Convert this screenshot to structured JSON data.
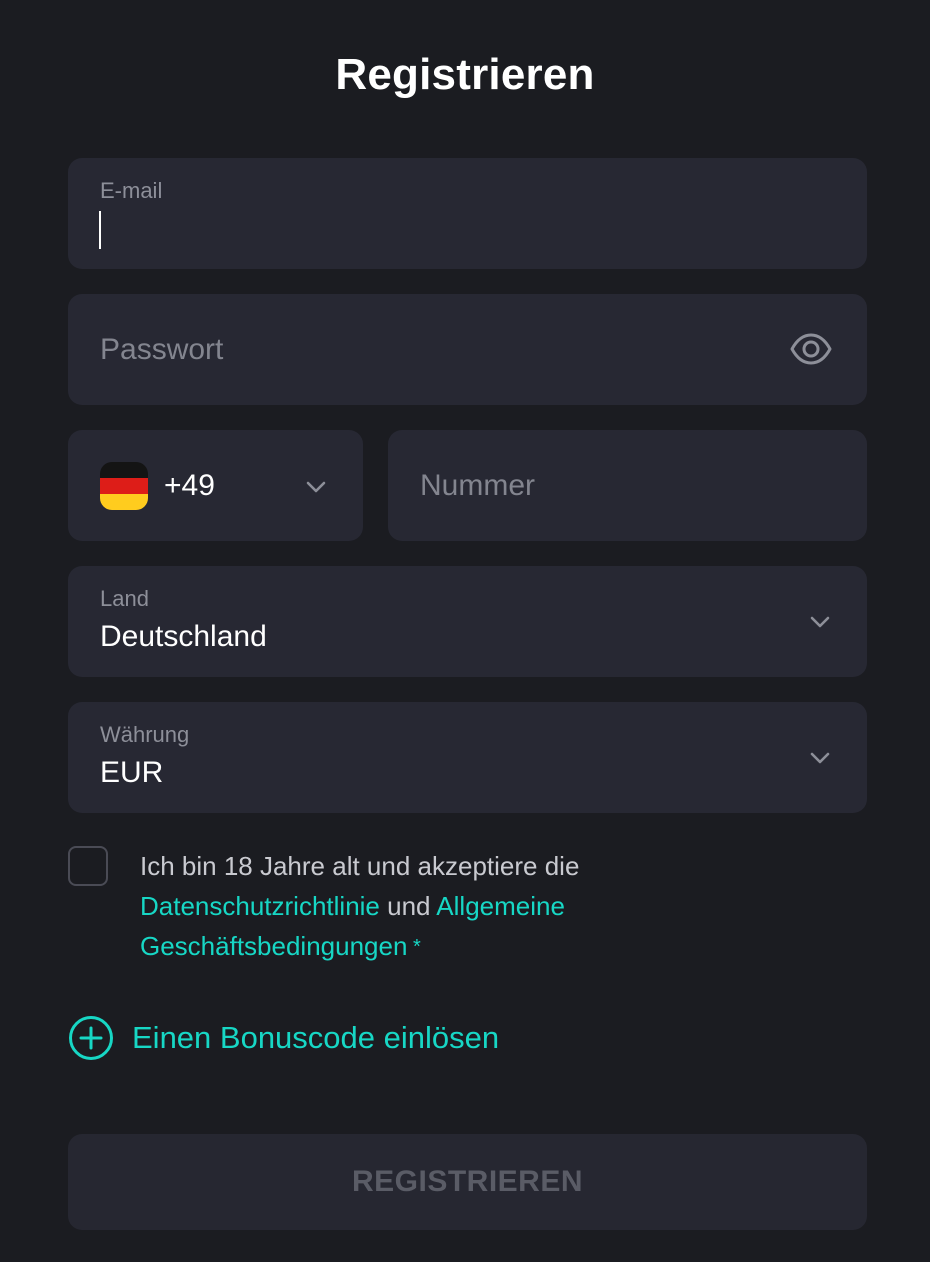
{
  "title": "Registrieren",
  "email": {
    "label": "E-mail",
    "value": ""
  },
  "password": {
    "placeholder": "Passwort",
    "icon": "eye-icon"
  },
  "phone": {
    "country_code": "+49",
    "flag": "germany-flag-icon",
    "number_placeholder": "Nummer"
  },
  "country": {
    "label": "Land",
    "value": "Deutschland"
  },
  "currency": {
    "label": "Währung",
    "value": "EUR"
  },
  "consent": {
    "checked": false,
    "text_before": "Ich bin 18 Jahre alt und akzeptiere die ",
    "privacy_link": "Datenschutzrichtlinie",
    "text_between": " und ",
    "terms_link": "Allgemeine Geschäftsbedingungen",
    "required_mark": " *"
  },
  "bonus": {
    "label": "Einen Bonuscode einlösen",
    "icon": "plus-circle-icon"
  },
  "submit_label": "REGISTRIEREN",
  "colors": {
    "background": "#1b1c21",
    "field": "#272833",
    "accent": "#17d7c5",
    "muted_text": "#8d8f99",
    "disabled_button_text": "#5a5c66"
  }
}
